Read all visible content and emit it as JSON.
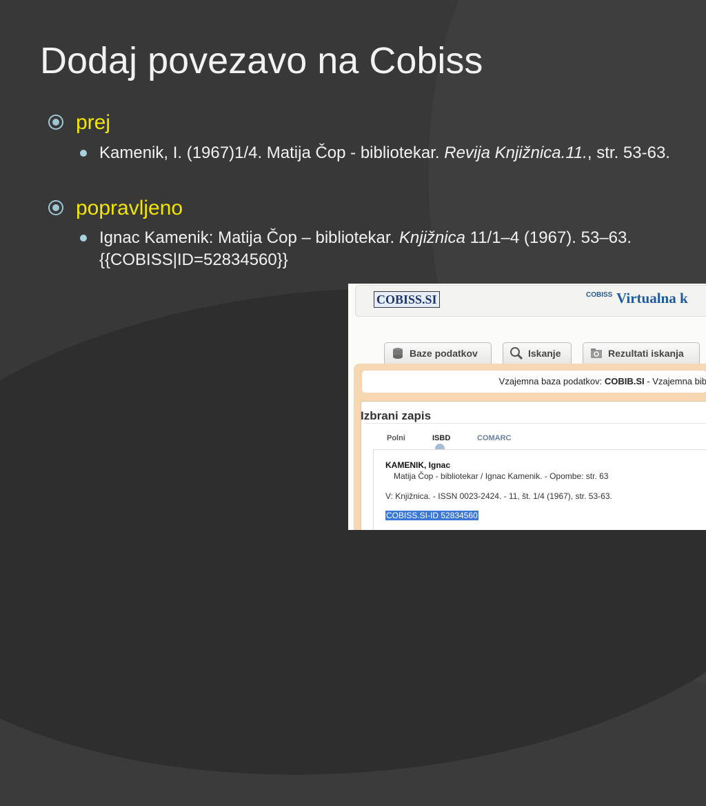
{
  "title": "Dodaj povezavo na Cobiss",
  "sections": [
    {
      "heading": "prej",
      "item": {
        "text_before": "Kamenik, I. (1967)1/4. Matija Čop - bibliotekar. ",
        "italic": "Revija Knjižnica.11.",
        "text_after": ", str. 53-63."
      }
    },
    {
      "heading": "popravljeno",
      "item": {
        "text_before": "Ignac Kamenik: Matija Čop – bibliotekar. ",
        "italic": "Knjižnica",
        "text_after": " 11/1–4 (1967). 53–63. {{COBISS|ID=52834560}}"
      }
    }
  ],
  "screenshot": {
    "logo": "COBISS.SI",
    "badge": "COBISS",
    "header_title": "Virtualna k",
    "tabs": [
      "Baze podatkov",
      "Iskanje",
      "Rezultati iskanja"
    ],
    "banner_prefix": "Vzajemna baza podatkov: ",
    "banner_bold": "COBIB.SI",
    "banner_suffix": " - Vzajemna bib",
    "record_title": "Izbrani zapis",
    "view_tabs": [
      "Polni",
      "ISBD",
      "COMARC"
    ],
    "record_lines": [
      "KAMENIK, Ignac",
      "Matija Čop - bibliotekar / Ignac Kamenik. - Opombe: str. 63",
      "V: Knjižnica. - ISSN 0023-2424. - 11, št. 1/4 (1967), str. 53-63.",
      "COBISS.SI-ID 52834560"
    ]
  }
}
